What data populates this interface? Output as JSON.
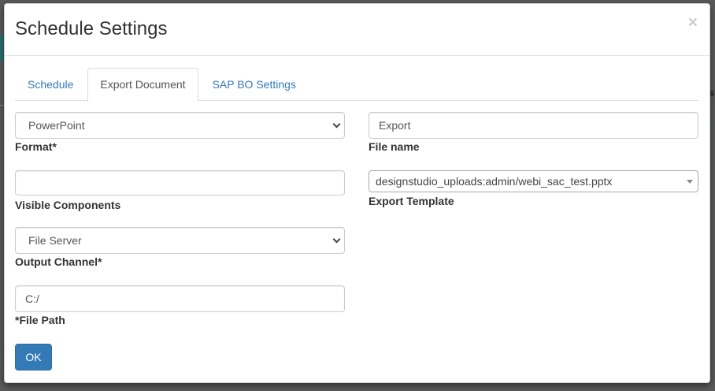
{
  "modal": {
    "title": "Schedule Settings",
    "close_label": "×"
  },
  "tabs": [
    {
      "label": "Schedule",
      "active": false
    },
    {
      "label": "Export Document",
      "active": true
    },
    {
      "label": "SAP BO Settings",
      "active": false
    }
  ],
  "form": {
    "format": {
      "value": "PowerPoint",
      "label": "Format*"
    },
    "file_name": {
      "value": "Export",
      "label": "File name"
    },
    "visible_components": {
      "value": "",
      "label": "Visible Components"
    },
    "export_template": {
      "value": "designstudio_uploads:admin/webi_sac_test.pptx",
      "label": "Export Template"
    },
    "output_channel": {
      "value": "File Server",
      "label": "Output Channel*"
    },
    "file_path": {
      "value": "C:/",
      "label": "*File Path"
    }
  },
  "ok_label": "OK",
  "colors": {
    "primary": "#337ab7",
    "link": "#337ab7",
    "overlay": "#5a5a5a"
  }
}
